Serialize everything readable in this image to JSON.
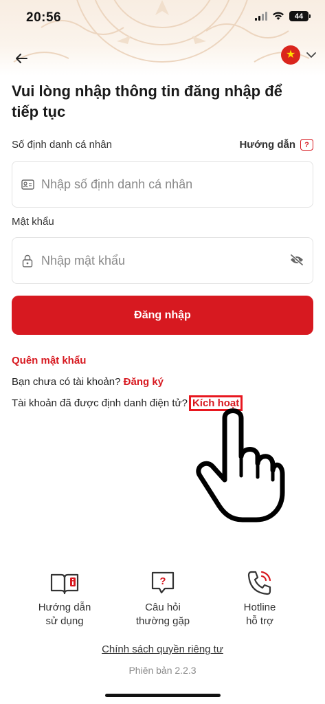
{
  "status_bar": {
    "time": "20:56",
    "battery": "44"
  },
  "header": {
    "language_flag": "vietnam-flag",
    "title": "Vui lòng nhập thông tin đăng nhập để tiếp tục"
  },
  "id_field": {
    "label": "Số định danh cá nhân",
    "placeholder": "Nhập số định danh cá nhân"
  },
  "guide": {
    "label": "Hướng dẫn",
    "icon_text": "?"
  },
  "password_field": {
    "label": "Mật khẩu",
    "placeholder": "Nhập mật khẩu"
  },
  "login_button": {
    "label": "Đăng nhập"
  },
  "links": {
    "forgot_password": "Quên mật khẩu",
    "no_account_text": "Bạn chưa có tài khoản?",
    "register": "Đăng ký",
    "identified_text": "Tài khoản đã được định danh điện tử?",
    "activate": "Kích hoạt"
  },
  "support": {
    "user_guide": [
      "Hướng dẫn",
      "sử dụng"
    ],
    "faq": [
      "Câu hỏi",
      "thường gặp"
    ],
    "hotline": [
      "Hotline",
      "hỗ trợ"
    ]
  },
  "footer": {
    "privacy": "Chính sách quyền riêng tư",
    "version": "Phiên bản 2.2.3"
  },
  "colors": {
    "primary_red": "#d71920",
    "text": "#1a1a1a",
    "placeholder": "#8a8a8a"
  }
}
